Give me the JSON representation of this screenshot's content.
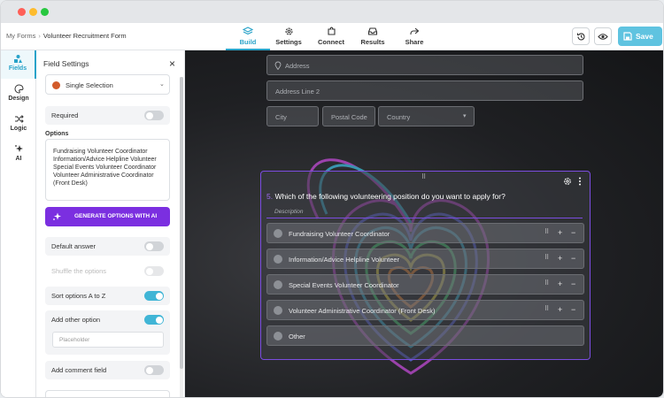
{
  "breadcrumb": {
    "root": "My Forms",
    "separator": "›",
    "current": "Volunteer Recruitment Form"
  },
  "tabs": [
    {
      "label": "Build",
      "icon": "layers-icon",
      "active": true
    },
    {
      "label": "Settings",
      "icon": "gear-icon"
    },
    {
      "label": "Connect",
      "icon": "puzzle-icon"
    },
    {
      "label": "Results",
      "icon": "inbox-icon"
    },
    {
      "label": "Share",
      "icon": "share-icon"
    }
  ],
  "actions": {
    "save_label": "Save"
  },
  "leftnav": [
    {
      "label": "Fields",
      "icon": "shapes-icon",
      "active": true
    },
    {
      "label": "Design",
      "icon": "palette-icon"
    },
    {
      "label": "Logic",
      "icon": "shuffle-icon"
    },
    {
      "label": "AI",
      "icon": "sparkle-icon"
    }
  ],
  "field_settings": {
    "title": "Field Settings",
    "close": "×",
    "field_type": "Single Selection",
    "required_label": "Required",
    "required": false,
    "options_label": "Options",
    "options_text": "Fundraising Volunteer Coordinator\nInformation/Advice Helpline Volunteer\nSpecial Events Volunteer Coordinator\nVolunteer Administrative Coordinator (Front Desk)",
    "generate_label": "GENERATE OPTIONS WITH AI",
    "default_answer_label": "Default answer",
    "default_answer": false,
    "shuffle_label": "Shuffle the options",
    "shuffle": false,
    "sort_label": "Sort options A to Z",
    "sort": true,
    "add_other_label": "Add other option",
    "add_other": true,
    "other_placeholder": "Placeholder",
    "comment_label": "Add comment field",
    "comment": false
  },
  "canvas": {
    "address_placeholder": "Address",
    "address2_placeholder": "Address Line 2",
    "city_placeholder": "City",
    "postal_placeholder": "Postal Code",
    "country_placeholder": "Country",
    "question_number": "5.",
    "question_text": "Which of the following volunteering position do you want to apply for?",
    "description_placeholder": "Description",
    "options": [
      "Fundraising Volunteer Coordinator",
      "Information/Advice Helpline Volunteer",
      "Special Events Volunteer Coordinator",
      "Volunteer Administrative Coordinator (Front Desk)"
    ],
    "other_label": "Other"
  },
  "colors": {
    "accent": "#29a3c9",
    "save": "#5fc3e0",
    "ai_button": "#7b2fe0",
    "question_border": "#7b4de0"
  }
}
